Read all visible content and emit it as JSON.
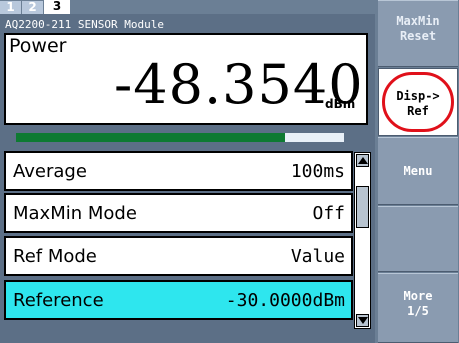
{
  "tabs": [
    "1",
    "2",
    "3"
  ],
  "active_tab": "3",
  "module_title": "AQ2200-211 SENSOR Module",
  "measurement": {
    "label": "Power",
    "value": "-48.3540",
    "unit": "dBm",
    "bar_level_fraction": 0.82
  },
  "settings": [
    {
      "label": "Average",
      "value": "100ms",
      "selected": false
    },
    {
      "label": "MaxMin Mode",
      "value": "Off",
      "selected": false
    },
    {
      "label": "Ref Mode",
      "value": "Value",
      "selected": false
    },
    {
      "label": "Reference",
      "value": "-30.0000dBm",
      "selected": true
    }
  ],
  "softkeys": {
    "k1": {
      "line1": "MaxMin",
      "line2": "Reset"
    },
    "k2": {
      "line1": "Disp->",
      "line2": "Ref"
    },
    "k3": {
      "line1": "Menu"
    },
    "k5": {
      "line1": "More",
      "line2": "1/5"
    }
  },
  "colors": {
    "selected_row": "#2ee6ee",
    "panel_bg": "#5c6f86",
    "bar_fill": "#0e7a32",
    "highlight_circle": "#e0101a"
  }
}
